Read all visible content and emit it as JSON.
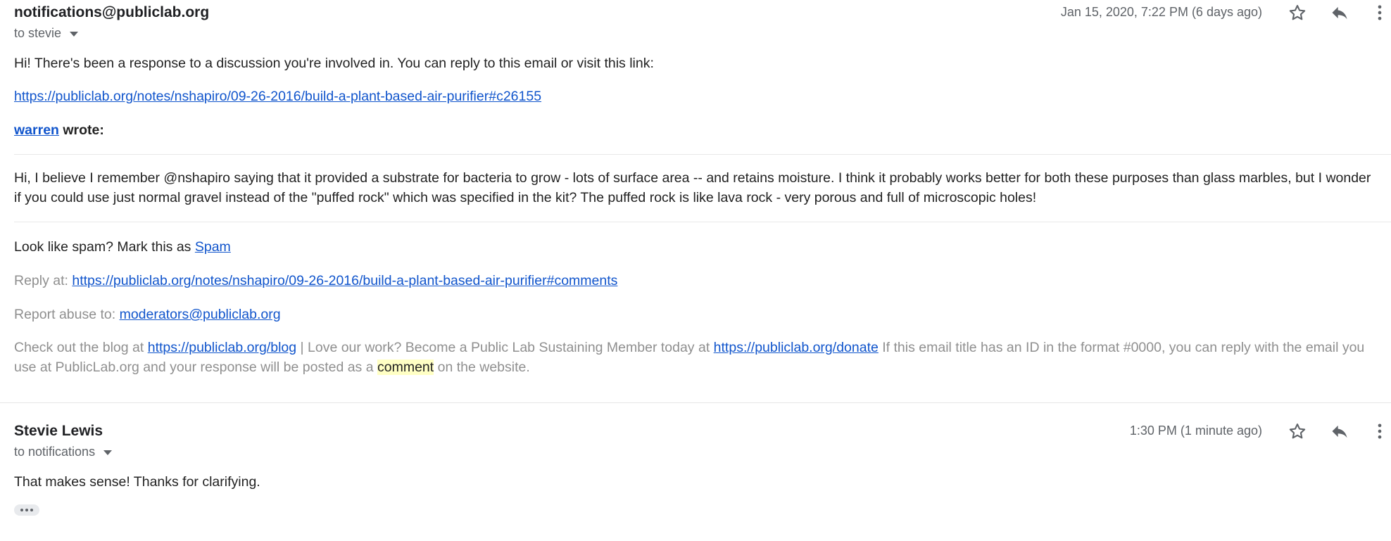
{
  "messages": [
    {
      "sender": "notifications@publiclab.org",
      "to": "to stevie",
      "date": "Jan 15, 2020, 7:22 PM (6 days ago)",
      "intro": "Hi! There's been a response to a discussion you're involved in. You can reply to this email or visit this link:",
      "link": "https://publiclab.org/notes/nshapiro/09-26-2016/build-a-plant-based-air-purifier#c26155",
      "author": "warren",
      "wrote": " wrote:",
      "quote": "Hi, I believe I remember @nshapiro saying that it provided a substrate for bacteria to grow - lots of surface area -- and retains moisture. I think it probably works better for both these purposes than glass marbles, but I wonder if you could use just normal gravel instead of the \"puffed rock\" which was specified in the kit? The puffed rock is like lava rock - very porous and full of microscopic holes!",
      "spam_prefix": "Look like spam? Mark this as ",
      "spam_link": "Spam",
      "reply_prefix": "Reply at: ",
      "reply_link": "https://publiclab.org/notes/nshapiro/09-26-2016/build-a-plant-based-air-purifier#comments",
      "report_prefix": "Report abuse to: ",
      "report_link": "moderators@publiclab.org",
      "footer_a": "Check out the blog at ",
      "footer_blog_link": "https://publiclab.org/blog",
      "footer_b": " | Love our work? Become a Public Lab Sustaining Member today at ",
      "footer_donate_link": "https://publiclab.org/donate",
      "footer_c": " If this email title has an ID in the format #0000, you can reply with the email you use at PublicLab.org and your response will be posted as a ",
      "footer_highlight": "comment",
      "footer_d": " on the website."
    },
    {
      "sender": "Stevie Lewis",
      "to": "to notifications",
      "date": "1:30 PM (1 minute ago)",
      "body": "That makes sense! Thanks for clarifying."
    }
  ],
  "icons": {
    "star": "star-icon",
    "reply": "reply-icon",
    "more": "more-vert-icon",
    "caret": "caret-down-icon",
    "ellipsis": "ellipsis-icon"
  },
  "colors": {
    "link": "#1155cc",
    "muted": "#8f8f8f",
    "highlight": "#ffffc4",
    "icon": "#5f6368"
  }
}
